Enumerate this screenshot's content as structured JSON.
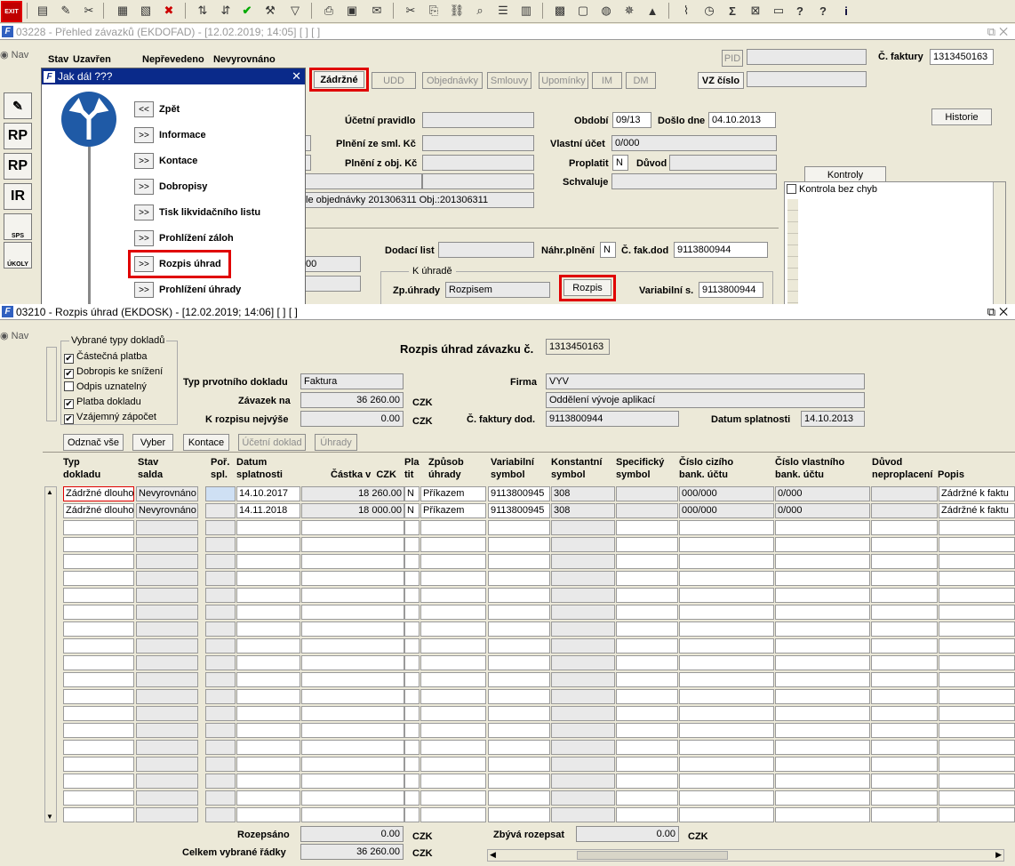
{
  "toolbar": {
    "exit_label": "EXIT"
  },
  "back_window": {
    "title": "03228 - Přehled závazků (EKDOFAD) - [12.02.2019; 14:05]  [ ]  [ ]",
    "nav": "Nav",
    "status_headers": [
      "Stav",
      "Uzavřen",
      "Nepřevedeno",
      "Nevyrovnáno"
    ],
    "tabs": [
      "Zádržné",
      "UDD",
      "Objednávky",
      "Smlouvy",
      "Upomínky",
      "IM",
      "DM"
    ],
    "pid_label": "PID",
    "faktura_label": "Č. faktury",
    "faktura_value": "1313450163",
    "vz_label": "VZ číslo",
    "historie": "Historie",
    "ucetni_pravidlo": "Účetní pravidlo",
    "plneni_sml": "Plnění ze sml. Kč",
    "plneni_obj": "Plnění z obj. Kč",
    "obdobi_label": "Období",
    "obdobi_value": "09/13",
    "doslo_label": "Došlo dne",
    "doslo_value": "04.10.2013",
    "vlastni_ucet_label": "Vlastní účet",
    "vlastni_ucet_value": "0/000",
    "proplatit_label": "Proplatit",
    "proplatit_value": "N",
    "duvod_label": "Důvod",
    "schvaluje_label": "Schvaluje",
    "kontroly_tab": "Kontroly",
    "kontrola_item": "Kontrola bez chyb",
    "objednavky_text": "le objednávky 201306311 Obj.:201306311",
    "dodaci_list": "Dodací list",
    "nahr_plneni_label": "Náhr.plnění",
    "nahr_plneni_value": "N",
    "c_fak_dod_label": "Č. fak.dod",
    "c_fak_dod_value": "9113800944",
    "k_uhrade": "K úhradě",
    "zp_uhrady_label": "Zp.úhrady",
    "zp_uhrady_value": "Rozpisem",
    "rozpis_btn": "Rozpis",
    "variabilni_label": "Variabilní s.",
    "variabilni_value": "9113800944",
    "partial_value": "00"
  },
  "dialog": {
    "title": "Jak dál ???",
    "items": [
      {
        "btn": "<<",
        "label": "Zpět"
      },
      {
        "btn": ">>",
        "label": "Informace"
      },
      {
        "btn": ">>",
        "label": "Kontace"
      },
      {
        "btn": ">>",
        "label": "Dobropisy"
      },
      {
        "btn": ">>",
        "label": "Tisk likvidačního listu"
      },
      {
        "btn": ">>",
        "label": "Prohlížení záloh"
      },
      {
        "btn": ">>",
        "label": "Rozpis úhrad"
      },
      {
        "btn": ">>",
        "label": "Prohlížení úhrady"
      }
    ]
  },
  "left_icons": [
    "RP",
    "RP",
    "IR",
    "SPS",
    "ÚKOLY"
  ],
  "front_window": {
    "title": "03210 - Rozpis úhrad (EKDOSK) - [12.02.2019; 14:06]  [ ]  [ ]",
    "nav": "Nav",
    "group_title": "Vybrané typy dokladů",
    "doc_types": [
      {
        "label": "Částečná platba",
        "checked": true
      },
      {
        "label": "Dobropis ke snížení",
        "checked": true
      },
      {
        "label": "Odpis uznatelný",
        "checked": false
      },
      {
        "label": "Platba dokladu",
        "checked": true
      },
      {
        "label": "Vzájemný zápočet",
        "checked": true
      }
    ],
    "heading": "Rozpis úhrad závazku č.",
    "heading_value": "1313450163",
    "typ_label": "Typ prvotního dokladu",
    "typ_value": "Faktura",
    "zavazek_label": "Závazek na",
    "zavazek_value": "36 260.00",
    "czk": "CZK",
    "k_rozpisu_label": "K rozpisu nejvýše",
    "k_rozpisu_value": "0.00",
    "firma_label": "Firma",
    "firma_value": "VYV",
    "firma_sub": "Oddělení vývoje aplikací",
    "c_faktury_label": "Č. faktury dod.",
    "c_faktury_value": "9113800944",
    "datum_label": "Datum splatnosti",
    "datum_value": "14.10.2013",
    "buttons": [
      "Odznač vše",
      "Vyber",
      "Kontace",
      "Účetní doklad",
      "Úhrady"
    ],
    "columns": [
      "Typ\ndokladu",
      "Stav\nsalda",
      "Poř.\nspl.",
      "Datum\nsplatnosti",
      "Částka v  CZK",
      "Pla\ntit",
      "Způsob\núhrady",
      "Variabilní\nsymbol",
      "Konstantní\nsymbol",
      "Specifický\nsymbol",
      "Číslo cizího\nbank. účtu",
      "Číslo vlastního\nbank. účtu",
      "Důvod\nneproplacení",
      "Popis"
    ],
    "rows": [
      [
        "Zádržné dlouho",
        "Nevyrovnáno",
        "",
        "14.10.2017",
        "18 260.00",
        "N",
        "Příkazem",
        "9113800945",
        "308",
        "",
        "000/000",
        "0/000",
        "",
        "Zádržné k faktu"
      ],
      [
        "Zádržné dlouho",
        "Nevyrovnáno",
        "",
        "14.11.2018",
        "18 000.00",
        "N",
        "Příkazem",
        "9113800945",
        "308",
        "",
        "000/000",
        "0/000",
        "",
        "Zádržné k faktu"
      ]
    ],
    "rozepsano_label": "Rozepsáno",
    "rozepsano_value": "0.00",
    "celkem_label": "Celkem vybrané řádky",
    "celkem_value": "36 260.00",
    "zbyva_label": "Zbývá rozepsat",
    "zbyva_value": "0.00"
  }
}
